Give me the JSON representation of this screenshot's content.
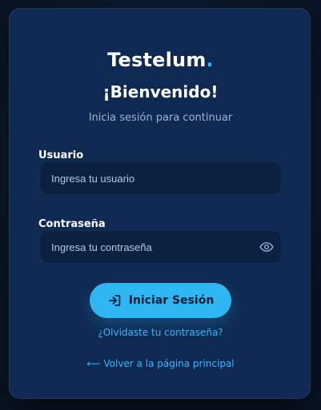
{
  "brand": {
    "name": "Testelum",
    "dot": "."
  },
  "login": {
    "title": "¡Bienvenido!",
    "subtitle": "Inicia sesión para continuar",
    "username_label": "Usuario",
    "username_placeholder": "Ingresa tu usuario",
    "password_label": "Contraseña",
    "password_placeholder": "Ingresa tu contraseña",
    "submit_label": "Iniciar Sesión",
    "forgot_label": "¿Olvidaste tu contraseña?",
    "back_label": "⟵ Volver a la página principal"
  },
  "icons": {
    "password_toggle": "eye-icon",
    "submit": "sign-in-icon"
  },
  "colors": {
    "card": "#0f2a52",
    "accent": "#2fb6f2",
    "link": "#39b5ff"
  }
}
